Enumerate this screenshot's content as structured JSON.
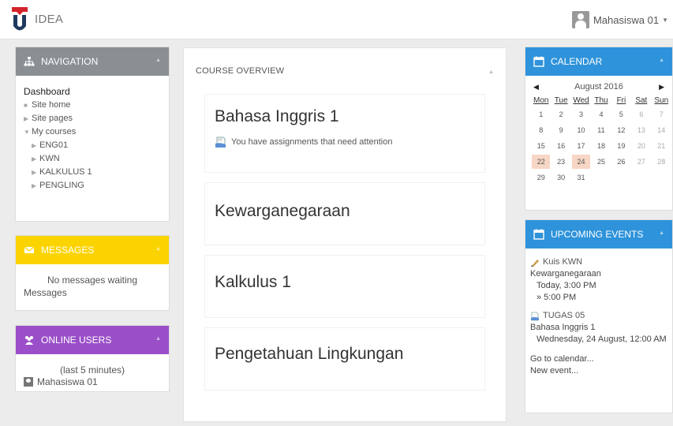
{
  "header": {
    "site_name": "IDEA",
    "user_name": "Mahasiswa 01"
  },
  "navigation": {
    "title": "NAVIGATION",
    "dashboard": "Dashboard",
    "items": [
      {
        "label": "Site home",
        "marker": "■"
      },
      {
        "label": "Site pages",
        "marker": "▶"
      },
      {
        "label": "My courses",
        "marker": "▼"
      }
    ],
    "courses": [
      "ENG01",
      "KWN",
      "KALKULUS 1",
      "PENGLING"
    ]
  },
  "messages": {
    "title": "MESSAGES",
    "status": "No messages waiting",
    "link": "Messages"
  },
  "online_users": {
    "title": "ONLINE USERS",
    "period": "(last 5 minutes)",
    "users": [
      "Mahasiswa 01"
    ]
  },
  "course_overview": {
    "title": "COURSE OVERVIEW",
    "courses": [
      {
        "name": "Bahasa Inggris 1",
        "note": "You have assignments that need attention"
      },
      {
        "name": "Kewarganegaraan"
      },
      {
        "name": "Kalkulus 1"
      },
      {
        "name": "Pengetahuan Lingkungan"
      }
    ]
  },
  "calendar": {
    "title": "CALENDAR",
    "month": "August 2016",
    "prev": "◀",
    "next": "▶",
    "weekdays": [
      "Mon",
      "Tue",
      "Wed",
      "Thu",
      "Fri",
      "Sat",
      "Sun"
    ],
    "weeks": [
      [
        "1",
        "2",
        "3",
        "4",
        "5",
        "6",
        "7"
      ],
      [
        "8",
        "9",
        "10",
        "11",
        "12",
        "13",
        "14"
      ],
      [
        "15",
        "16",
        "17",
        "18",
        "19",
        "20",
        "21"
      ],
      [
        "22",
        "23",
        "24",
        "25",
        "26",
        "27",
        "28"
      ],
      [
        "29",
        "30",
        "31",
        "",
        "",
        "",
        ""
      ]
    ],
    "event_days": [
      "22",
      "24"
    ]
  },
  "upcoming_events": {
    "title": "UPCOMING EVENTS",
    "events": [
      {
        "name": "Kuis KWN",
        "course": "Kewarganegaraan",
        "time1": "Today, 3:00 PM",
        "time2": "» 5:00 PM"
      },
      {
        "name": "TUGAS 05",
        "course": "Bahasa Inggris 1",
        "time1": "Wednesday, 24 August, 12:00 AM"
      }
    ],
    "go_to_calendar": "Go to calendar...",
    "new_event": "New event..."
  },
  "colors": {
    "navigation_header": "#8a8f93",
    "messages_header": "#fbd400",
    "online_users_header": "#9a4fc8",
    "calendar_header": "#2e93da",
    "event_day": "#f7d6c5"
  }
}
